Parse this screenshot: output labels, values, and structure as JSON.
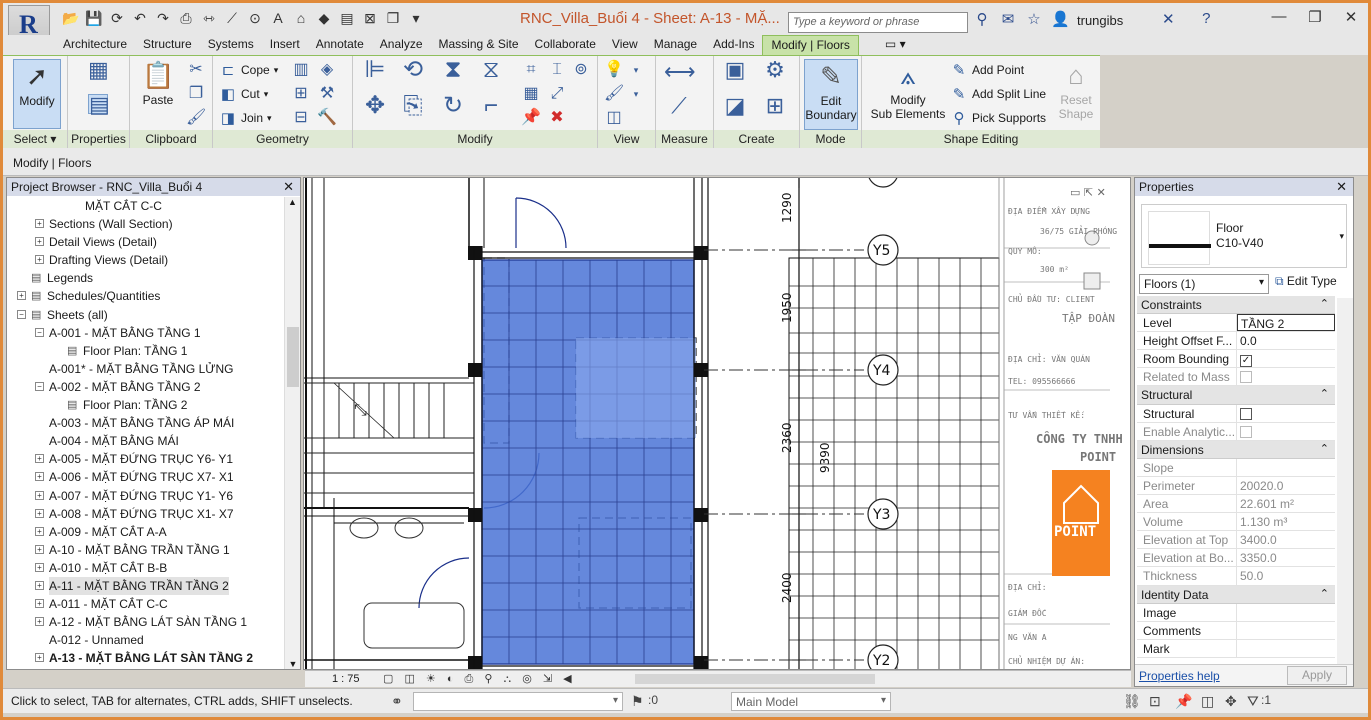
{
  "app": {
    "logo": "R"
  },
  "title": "RNC_Villa_Buổi 4 - Sheet: A-13 - MẶ...",
  "search": {
    "placeholder": "Type a keyword or phrase"
  },
  "user": "trungibs",
  "tabs": [
    "Architecture",
    "Structure",
    "Systems",
    "Insert",
    "Annotate",
    "Analyze",
    "Massing & Site",
    "Collaborate",
    "View",
    "Manage",
    "Add-Ins",
    "Modify | Floors"
  ],
  "ribbon": {
    "modify": "Modify",
    "select_label": "Select",
    "properties_label": "Properties",
    "paste": "Paste",
    "clipboard_label": "Clipboard",
    "cope": "Cope",
    "cut": "Cut",
    "join": "Join",
    "geometry_label": "Geometry",
    "modify_label": "Modify",
    "view_label": "View",
    "measure_label": "Measure",
    "create_label": "Create",
    "edit_boundary": [
      "Edit",
      "Boundary"
    ],
    "mode_label": "Mode",
    "modify_sub": [
      "Modify",
      "Sub Elements"
    ],
    "add_point": "Add Point",
    "add_split_line": "Add Split Line",
    "pick_supports": "Pick Supports",
    "reset_shape": [
      "Reset",
      "Shape"
    ],
    "shape_editing_label": "Shape Editing"
  },
  "context_bar": "Modify | Floors",
  "project_browser": {
    "title": "Project Browser - RNC_Villa_Buổi 4",
    "items": [
      {
        "text": "MẶT CẮT C-C",
        "level": 3,
        "exp": ""
      },
      {
        "text": "Sections (Wall Section)",
        "level": 1,
        "exp": "+"
      },
      {
        "text": "Detail Views (Detail)",
        "level": 1,
        "exp": "+"
      },
      {
        "text": "Drafting Views (Detail)",
        "level": 1,
        "exp": "+"
      },
      {
        "text": "Legends",
        "level": 0,
        "exp": "",
        "icon": true
      },
      {
        "text": "Schedules/Quantities",
        "level": 0,
        "exp": "+",
        "icon": true
      },
      {
        "text": "Sheets (all)",
        "level": 0,
        "exp": "−",
        "icon": true
      },
      {
        "text": "A-001 - MẶT BẰNG TẦNG 1",
        "level": 1,
        "exp": "−"
      },
      {
        "text": "Floor Plan: TẦNG 1",
        "level": 2,
        "exp": "",
        "icon": true
      },
      {
        "text": "A-001* - MẶT BẰNG TẦNG LỬNG",
        "level": 1,
        "exp": ""
      },
      {
        "text": "A-002 - MẶT BẰNG TẦNG 2",
        "level": 1,
        "exp": "−"
      },
      {
        "text": "Floor Plan: TẦNG 2",
        "level": 2,
        "exp": "",
        "icon": true
      },
      {
        "text": "A-003 - MẶT BẰNG TẦNG ÁP MÁI",
        "level": 1,
        "exp": ""
      },
      {
        "text": "A-004 - MẶT BẰNG MÁI",
        "level": 1,
        "exp": ""
      },
      {
        "text": "A-005 - MẶT ĐỨNG TRỤC Y6- Y1",
        "level": 1,
        "exp": "+"
      },
      {
        "text": "A-006 - MẶT ĐỨNG TRỤC X7- X1",
        "level": 1,
        "exp": "+"
      },
      {
        "text": "A-007 - MẶT ĐỨNG TRỤC Y1- Y6",
        "level": 1,
        "exp": "+"
      },
      {
        "text": "A-008 - MẶT ĐỨNG TRỤC X1- X7",
        "level": 1,
        "exp": "+"
      },
      {
        "text": "A-009 - MẶT CẮT A-A",
        "level": 1,
        "exp": "+"
      },
      {
        "text": "A-10 - MẶT BẰNG TRẦN TẦNG 1",
        "level": 1,
        "exp": "+"
      },
      {
        "text": "A-010 - MẶT CẮT B-B",
        "level": 1,
        "exp": "+"
      },
      {
        "text": "A-11 - MẶT BẰNG TRẦN TẦNG 2",
        "level": 1,
        "exp": "+",
        "sel": true
      },
      {
        "text": "A-011 - MẶT CẮT C-C",
        "level": 1,
        "exp": "+"
      },
      {
        "text": "A-12 - MẶT BẰNG LÁT SÀN TẦNG 1",
        "level": 1,
        "exp": "+"
      },
      {
        "text": "A-012 - Unnamed",
        "level": 1,
        "exp": ""
      },
      {
        "text": "A-13 - MẶT BẰNG LÁT SÀN TẦNG 2",
        "level": 1,
        "exp": "+",
        "bold": true
      }
    ]
  },
  "drawing": {
    "grid_labels": [
      "Y5",
      "Y4",
      "Y3",
      "Y2"
    ],
    "dims": [
      "1290",
      "1950",
      "2360",
      "9390",
      "2400"
    ],
    "titleblock": [
      "ĐỊA ĐIỂM XÂY DỰNG",
      "36/75 GIẢI PHÓNG",
      "QUY MÔ:",
      "300 m²",
      "CHỦ ĐẦU TƯ: CLIENT",
      "TẬP ĐOÀN",
      "ĐỊA CHỈ: VĂN QUÁN",
      "TEL: 095566666",
      "TƯ VẤN THIẾT KẾ:",
      "CÔNG TY TNHH",
      "POINT",
      "POINT",
      "ĐỊA CHỈ:",
      "GIÁM ĐỐC",
      "NG VĂN A",
      "CHỦ NHIỆM DỰ ÁN:"
    ],
    "scale": "1 : 75"
  },
  "properties": {
    "title": "Properties",
    "type_name": [
      "Floor",
      "C10-V40"
    ],
    "filter": "Floors (1)",
    "edit_type": "Edit Type",
    "sections": [
      {
        "name": "Constraints",
        "rows": [
          {
            "k": "Level",
            "v": "TẦNG 2",
            "edit": true
          },
          {
            "k": "Height Offset F...",
            "v": "0.0"
          },
          {
            "k": "Room Bounding",
            "v": "",
            "chk": "✓"
          },
          {
            "k": "Related to Mass",
            "v": "",
            "chk": "",
            "ro": true
          }
        ]
      },
      {
        "name": "Structural",
        "rows": [
          {
            "k": "Structural",
            "v": "",
            "chk": ""
          },
          {
            "k": "Enable Analytic...",
            "v": "",
            "chk": "",
            "ro": true
          }
        ]
      },
      {
        "name": "Dimensions",
        "rows": [
          {
            "k": "Slope",
            "v": "",
            "ro": true
          },
          {
            "k": "Perimeter",
            "v": "20020.0",
            "ro": true
          },
          {
            "k": "Area",
            "v": "22.601 m²",
            "ro": true
          },
          {
            "k": "Volume",
            "v": "1.130 m³",
            "ro": true
          },
          {
            "k": "Elevation at Top",
            "v": "3400.0",
            "ro": true
          },
          {
            "k": "Elevation at Bo...",
            "v": "3350.0",
            "ro": true
          },
          {
            "k": "Thickness",
            "v": "50.0",
            "ro": true
          }
        ]
      },
      {
        "name": "Identity Data",
        "rows": [
          {
            "k": "Image",
            "v": ""
          },
          {
            "k": "Comments",
            "v": ""
          },
          {
            "k": "Mark",
            "v": ""
          }
        ]
      }
    ],
    "help": "Properties help",
    "apply": "Apply"
  },
  "status": {
    "hint": "Click to select, TAB for alternates, CTRL adds, SHIFT unselects.",
    "count": ":0",
    "model": "Main Model",
    "filter_count": ":1"
  },
  "colors": {
    "selection": "#4a73d6",
    "accent_orange": "#f58220",
    "tab_active": "#c8e2a8"
  }
}
